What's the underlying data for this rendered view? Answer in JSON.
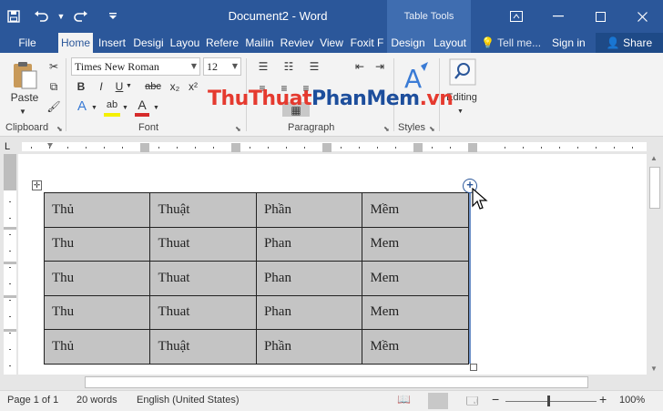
{
  "window": {
    "title": "Document2 - Word",
    "context_tab_group": "Table Tools",
    "accent_color": "#2b579a"
  },
  "qat": {
    "save_icon": "save-icon",
    "undo_icon": "undo-icon",
    "redo_icon": "redo-icon",
    "customize_icon": "customize-qat-icon"
  },
  "tabs": [
    {
      "label": "File"
    },
    {
      "label": "Home"
    },
    {
      "label": "Insert"
    },
    {
      "label": "Desigi"
    },
    {
      "label": "Layou"
    },
    {
      "label": "Refere"
    },
    {
      "label": "Mailin"
    },
    {
      "label": "Reviev"
    },
    {
      "label": "View"
    },
    {
      "label": "Foxit F"
    },
    {
      "label": "Design"
    },
    {
      "label": "Layout"
    }
  ],
  "tell_me": "Tell me...",
  "sign_in": "Sign in",
  "share": "Share",
  "ribbon": {
    "paste_label": "Paste",
    "clipboard_label": "Clipboard",
    "font_name": "Times New Roman",
    "font_size": "12",
    "font_label": "Font",
    "paragraph_label": "Paragraph",
    "styles_label": "Styles",
    "editing_label": "Editing",
    "bold": "B",
    "italic": "I",
    "underline": "U",
    "strikethrough": "abc",
    "subscript": "x₂",
    "superscript": "x²",
    "text_effects": "A",
    "highlight": "ab",
    "font_color": "A"
  },
  "watermark": {
    "part1": "ThuThuat",
    "part2": "PhanMem",
    "part3": ".vn"
  },
  "table": {
    "rows": [
      [
        "Thủ",
        "Thuật",
        "Phần",
        "Mềm"
      ],
      [
        "Thu",
        "Thuat",
        "Phan",
        "Mem"
      ],
      [
        "Thu",
        "Thuat",
        "Phan",
        "Mem"
      ],
      [
        "Thu",
        "Thuat",
        "Phan",
        "Mem"
      ],
      [
        "Thủ",
        "Thuật",
        "Phần",
        "Mềm"
      ]
    ],
    "fill_color": "#c4c4c4"
  },
  "status": {
    "page": "Page 1 of 1",
    "words": "20 words",
    "language": "English (United States)",
    "zoom": "100%"
  }
}
